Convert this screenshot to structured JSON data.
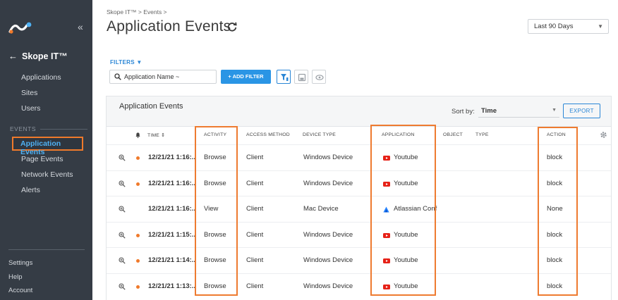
{
  "sidebar": {
    "back_label": "Skope IT™",
    "nav": [
      "Applications",
      "Sites",
      "Users"
    ],
    "events_section": "EVENTS",
    "events": [
      "Application Events",
      "Page Events",
      "Network Events",
      "Alerts"
    ],
    "bottom": [
      "Settings",
      "Help",
      "Account"
    ]
  },
  "header": {
    "breadcrumb": "Skope IT™ > Events >",
    "title": "Application Events",
    "range": "Last 90 Days"
  },
  "filters": {
    "label": "FILTERS ▼",
    "search_value": "Application Name ~",
    "add_filter": "+ ADD FILTER"
  },
  "card": {
    "title": "Application Events",
    "sort_label": "Sort by:",
    "sort_value": "Time",
    "export": "EXPORT"
  },
  "columns": {
    "time": "TIME ⇕",
    "activity": "ACTIVITY",
    "access": "ACCESS METHOD",
    "device": "DEVICE TYPE",
    "application": "APPLICATION",
    "object": "OBJECT",
    "type": "TYPE",
    "action": "ACTION"
  },
  "rows": [
    {
      "time": "12/21/21 1:16:..",
      "activity": "Browse",
      "access": "Client",
      "device": "Windows Device",
      "app": "Youtube",
      "action": "block",
      "alert": true,
      "app_icon": "youtube-icon"
    },
    {
      "time": "12/21/21 1:16:..",
      "activity": "Browse",
      "access": "Client",
      "device": "Windows Device",
      "app": "Youtube",
      "action": "block",
      "alert": true,
      "app_icon": "youtube-icon"
    },
    {
      "time": "12/21/21 1:16:..",
      "activity": "View",
      "access": "Client",
      "device": "Mac Device",
      "app": "Atlassian Conf",
      "action": "None",
      "alert": false,
      "app_icon": "atlassian-icon"
    },
    {
      "time": "12/21/21 1:15:..",
      "activity": "Browse",
      "access": "Client",
      "device": "Windows Device",
      "app": "Youtube",
      "action": "block",
      "alert": true,
      "app_icon": "youtube-icon"
    },
    {
      "time": "12/21/21 1:14:..",
      "activity": "Browse",
      "access": "Client",
      "device": "Windows Device",
      "app": "Youtube",
      "action": "block",
      "alert": true,
      "app_icon": "youtube-icon"
    },
    {
      "time": "12/21/21 1:13:..",
      "activity": "Browse",
      "access": "Client",
      "device": "Windows Device",
      "app": "Youtube",
      "action": "block",
      "alert": true,
      "app_icon": "youtube-icon"
    }
  ],
  "colors": {
    "sidebar_bg": "#353c45",
    "accent_blue": "#2a95e5",
    "highlight_orange": "#ee7b30",
    "youtube_red": "#e62117",
    "atlassian_blue": "#2684ff"
  }
}
